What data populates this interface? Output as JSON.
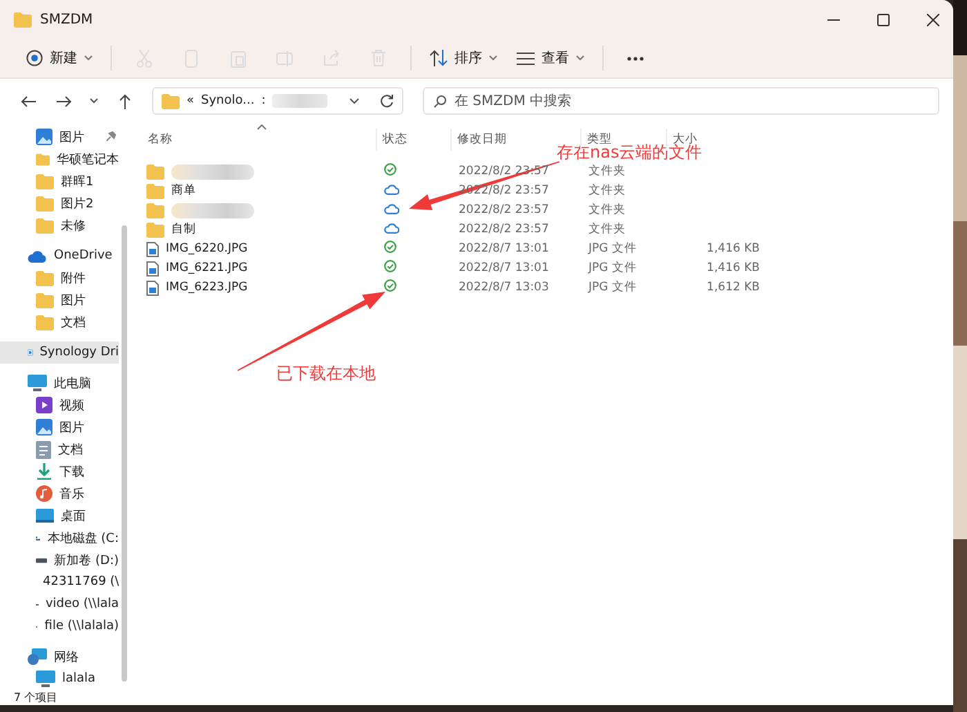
{
  "window": {
    "title": "SMZDM"
  },
  "toolbar": [
    {
      "kind": "dropdown",
      "label": "新建",
      "disabled": false
    },
    {
      "kind": "icon",
      "disabled": true
    },
    {
      "kind": "icon",
      "disabled": true
    },
    {
      "kind": "icon",
      "disabled": true
    },
    {
      "kind": "icon",
      "disabled": true
    },
    {
      "kind": "icon",
      "disabled": true
    },
    {
      "kind": "icon",
      "disabled": true
    },
    {
      "kind": "dropdown",
      "label": "排序",
      "disabled": false
    },
    {
      "kind": "dropdown",
      "label": "查看",
      "disabled": false
    },
    {
      "kind": "icon",
      "disabled": false
    }
  ],
  "address": {
    "prefix": "«",
    "segments": [
      "Synolo...",
      ":"
    ]
  },
  "search": {
    "placeholder": "在 SMZDM 中搜索"
  },
  "nav": [
    {
      "children": [
        {
          "label": "图片",
          "kind": "pictures",
          "pinned": true,
          "selected": false
        },
        {
          "label": "华硕笔记本",
          "kind": "folder",
          "pinned": false,
          "selected": false
        },
        {
          "label": "群晖1",
          "kind": "folder",
          "pinned": false,
          "selected": false
        },
        {
          "label": "图片2",
          "kind": "folder",
          "pinned": false,
          "selected": false
        },
        {
          "label": "未修",
          "kind": "folder",
          "pinned": false,
          "selected": false
        }
      ]
    },
    {
      "label": "OneDrive",
      "kind": "cloud",
      "selected": false,
      "children": [
        {
          "label": "附件",
          "kind": "folder",
          "pinned": false,
          "selected": false
        },
        {
          "label": "图片",
          "kind": "folder",
          "pinned": false,
          "selected": false
        },
        {
          "label": "文档",
          "kind": "folder",
          "pinned": false,
          "selected": false
        }
      ]
    },
    {
      "label": "Synology Dri",
      "kind": "synology",
      "selected": true
    },
    {
      "label": "此电脑",
      "kind": "pc",
      "selected": false,
      "children": [
        {
          "label": "视频",
          "kind": "videos",
          "pinned": false,
          "selected": false
        },
        {
          "label": "图片",
          "kind": "pictures",
          "pinned": false,
          "selected": false
        },
        {
          "label": "文档",
          "kind": "documents",
          "pinned": false,
          "selected": false
        },
        {
          "label": "下载",
          "kind": "downloads",
          "pinned": false,
          "selected": false
        },
        {
          "label": "音乐",
          "kind": "music",
          "pinned": false,
          "selected": false
        },
        {
          "label": "桌面",
          "kind": "desktop",
          "pinned": false,
          "selected": false
        },
        {
          "label": "本地磁盘 (C:",
          "kind": "system-drive",
          "pinned": false,
          "selected": false
        },
        {
          "label": "新加卷 (D:)",
          "kind": "drive",
          "pinned": false,
          "selected": false
        },
        {
          "label": "42311769 (\\",
          "kind": "disconnected-drive",
          "pinned": false,
          "selected": false
        },
        {
          "label": "video (\\\\lala",
          "kind": "network-drive",
          "pinned": false,
          "selected": false
        },
        {
          "label": "file (\\\\lalala)",
          "kind": "network-drive",
          "pinned": false,
          "selected": false
        }
      ]
    },
    {
      "label": "网络",
      "kind": "network",
      "selected": false,
      "children": [
        {
          "label": "lalala",
          "kind": "pc",
          "pinned": false,
          "selected": false
        }
      ]
    }
  ],
  "table": {
    "columns": [
      "名称",
      "状态",
      "修改日期",
      "类型",
      "大小"
    ],
    "rows": [
      {
        "kind": "folder",
        "redacted": true,
        "synced": true,
        "modified": "2022/8/2 23:57",
        "type": "文件夹"
      },
      {
        "kind": "folder",
        "redacted": false,
        "name": "商单",
        "synced": false,
        "modified": "2022/8/2 23:57",
        "type": "文件夹"
      },
      {
        "kind": "folder",
        "redacted": true,
        "synced": false,
        "modified": "2022/8/2 23:57",
        "type": "文件夹"
      },
      {
        "kind": "folder",
        "redacted": false,
        "name": "自制",
        "synced": false,
        "modified": "2022/8/2 23:57",
        "type": "文件夹"
      },
      {
        "kind": "file",
        "redacted": false,
        "name": "IMG_6220.JPG",
        "synced": true,
        "modified": "2022/8/7 13:01",
        "type": "JPG 文件",
        "size": "1,416 KB"
      },
      {
        "kind": "file",
        "redacted": false,
        "name": "IMG_6221.JPG",
        "synced": true,
        "modified": "2022/8/7 13:01",
        "type": "JPG 文件",
        "size": "1,416 KB"
      },
      {
        "kind": "file",
        "redacted": false,
        "name": "IMG_6223.JPG",
        "synced": true,
        "modified": "2022/8/7 13:03",
        "type": "JPG 文件",
        "size": "1,612 KB"
      }
    ]
  },
  "annotations": [
    {
      "text": "存在nas云端的文件"
    },
    {
      "text": "已下载在本地"
    }
  ],
  "status_bar": {
    "count": "7 个项目"
  }
}
